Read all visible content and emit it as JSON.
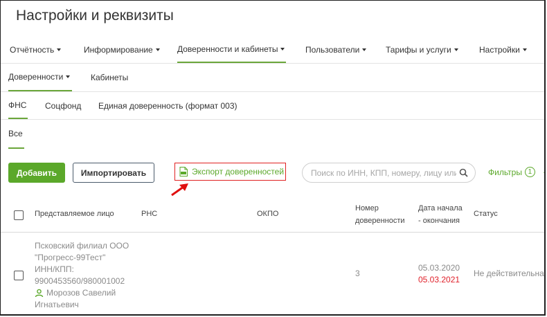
{
  "page_title": "Настройки и реквизиты",
  "main_nav": [
    {
      "label": "Отчётность"
    },
    {
      "label": "Информирование"
    },
    {
      "label": "Доверенности и кабинеты"
    },
    {
      "label": "Пользователи"
    },
    {
      "label": "Тарифы и услуги"
    },
    {
      "label": "Настройки"
    }
  ],
  "sub_nav": [
    {
      "label": "Доверенности"
    },
    {
      "label": "Кабинеты"
    }
  ],
  "org_tabs": [
    {
      "label": "ФНС"
    },
    {
      "label": "Соцфонд"
    },
    {
      "label": "Единая доверенность (формат 003)"
    }
  ],
  "filter_tabs": [
    {
      "label": "Все"
    }
  ],
  "toolbar": {
    "add_label": "Добавить",
    "import_label": "Импортировать",
    "export_label": "Экспорт доверенностей",
    "search_placeholder": "Поиск по ИНН, КПП, номеру, лицу или",
    "filters_label": "Фильтры",
    "filters_count": "1"
  },
  "table": {
    "headers": {
      "person": "Представляемое лицо",
      "rns": "РНС",
      "okpo": "ОКПО",
      "number_line1": "Номер",
      "number_line2": "доверенности",
      "dates_line1": "Дата начала",
      "dates_line2": "- окончания",
      "status": "Статус"
    },
    "rows": [
      {
        "org_line1": "Псковский филиал ООО",
        "org_line2": "\"Прогресс-99Тест\"",
        "inn_label": "ИНН/КПП:",
        "inn_value": "9900453560/980001002",
        "user_line1": "Морозов Савелий",
        "user_line2": "Игнатьевич",
        "number": "3",
        "date_start": "05.03.2020",
        "date_end": "05.03.2021",
        "status": "Не действительна"
      }
    ]
  },
  "colors": {
    "accent_green": "#5ba82a",
    "highlight_red": "#e02020",
    "expired_date_red": "#e0202a"
  },
  "icons": [
    "caret-down-icon",
    "xls-file-icon",
    "red-arrow-icon",
    "search-icon",
    "chevron-down-icon",
    "user-icon"
  ]
}
